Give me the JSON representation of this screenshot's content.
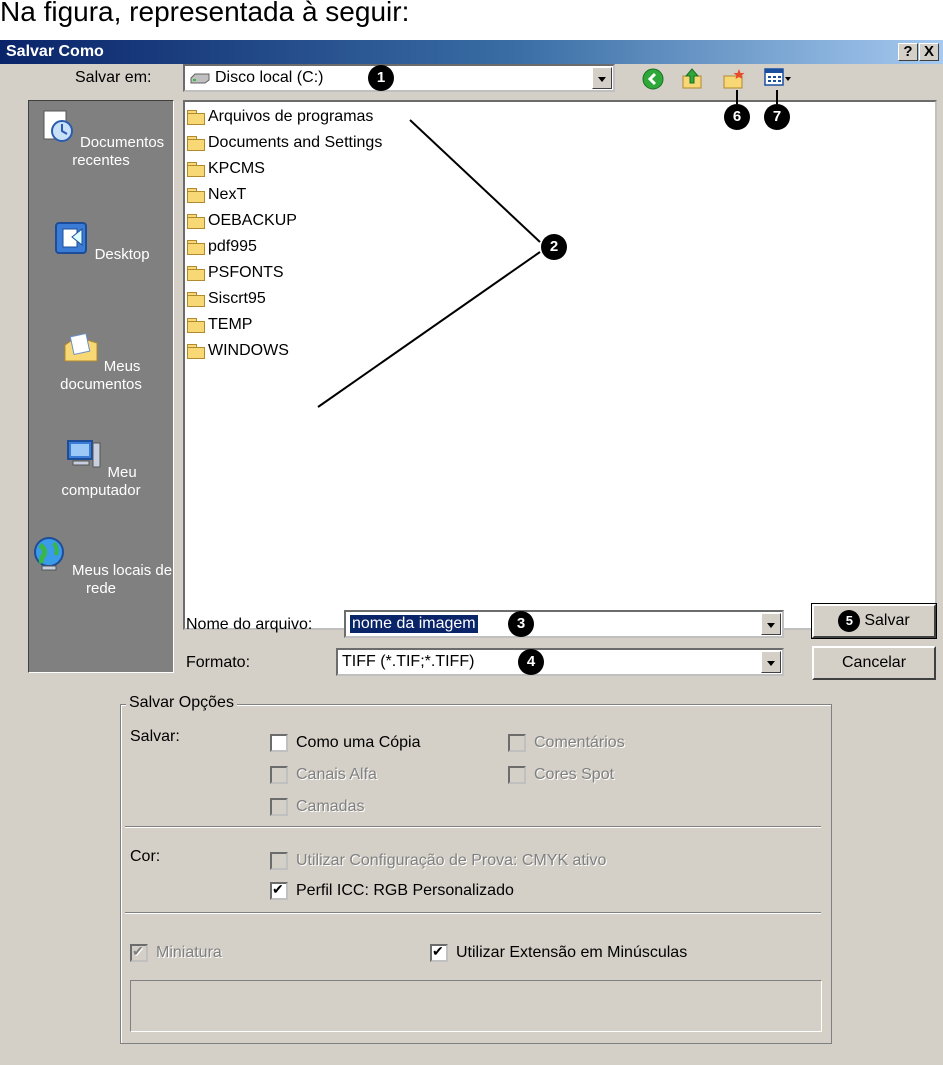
{
  "caption": "Na figura, representada à seguir:",
  "window": {
    "title": "Salvar Como",
    "help_btn": "?",
    "close_btn": "X"
  },
  "toolbar": {
    "save_in_label": "Salvar em:",
    "save_in_value": "Disco local (C:)"
  },
  "places": [
    {
      "label": "Documentos recentes",
      "icon": "recent-documents-icon"
    },
    {
      "label": "Desktop",
      "icon": "desktop-icon"
    },
    {
      "label": "Meus documentos",
      "icon": "my-documents-icon"
    },
    {
      "label": "Meu computador",
      "icon": "my-computer-icon"
    },
    {
      "label": "Meus locais de rede",
      "icon": "network-places-icon"
    }
  ],
  "folders": [
    "Arquivos de programas",
    "Documents and Settings",
    "KPCMS",
    "NexT",
    "OEBACKUP",
    "pdf995",
    "PSFONTS",
    "Siscrt95",
    "TEMP",
    "WINDOWS"
  ],
  "filename": {
    "label": "Nome do arquivo:",
    "value": "nome da imagem"
  },
  "format": {
    "label": "Formato:",
    "value": "TIFF (*.TIF;*.TIFF)"
  },
  "buttons": {
    "save": "Salvar",
    "cancel": "Cancelar"
  },
  "badges": [
    "1",
    "2",
    "3",
    "4",
    "5",
    "6",
    "7"
  ],
  "options": {
    "legend": "Salvar Opções",
    "save_label": "Salvar:",
    "as_copy": "Como uma Cópia",
    "alpha_channels": "Canais Alfa",
    "layers": "Camadas",
    "comments": "Comentários",
    "spot_colors": "Cores Spot",
    "color_label": "Cor:",
    "proof_setup": "Utilizar Configuração de Prova: CMYK ativo",
    "icc_profile": "Perfil ICC: RGB Personalizado",
    "thumbnail": "Miniatura",
    "lowercase_ext": "Utilizar Extensão em Minúsculas"
  }
}
